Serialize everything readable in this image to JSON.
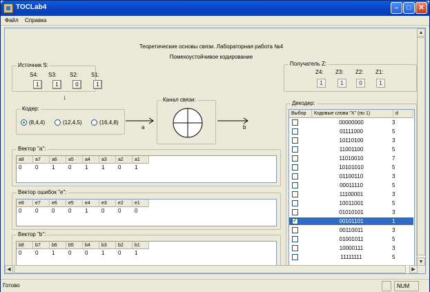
{
  "window": {
    "title": "TOCLab4"
  },
  "menu": {
    "file": "Файл",
    "help": "Справка"
  },
  "heading": {
    "line1": "Теоретические основы связи. Лабораторная работа №4",
    "line2": "Помехоустойчивое кодирование"
  },
  "source": {
    "label": "Источник S:",
    "bits": [
      {
        "name": "S4:",
        "value": "1"
      },
      {
        "name": "S3:",
        "value": "1"
      },
      {
        "name": "S2:",
        "value": "0"
      },
      {
        "name": "S1:",
        "value": "1"
      }
    ]
  },
  "receiver": {
    "label": "Получатель Z:",
    "bits": [
      {
        "name": "Z4:",
        "value": "1"
      },
      {
        "name": "Z3:",
        "value": "1"
      },
      {
        "name": "Z2:",
        "value": "0"
      },
      {
        "name": "Z1:",
        "value": "1"
      }
    ]
  },
  "coder": {
    "label": "Кодер:",
    "options": [
      "(8,4,4)",
      "(12,4,5)",
      "(16,4,8)"
    ],
    "selected": "(8,4,4)"
  },
  "channel": {
    "label": "Канал связи:"
  },
  "arrows": {
    "a": "a",
    "b": "b"
  },
  "vector_a": {
    "label": "Вектор \"a\":",
    "headers": [
      "a8",
      "a7",
      "a6",
      "a5",
      "a4",
      "a3",
      "a2",
      "a1"
    ],
    "values": [
      "0",
      "0",
      "1",
      "0",
      "1",
      "1",
      "0",
      "1"
    ]
  },
  "vector_e": {
    "label": "Вектор ошибок \"e\":",
    "headers": [
      "e8",
      "e7",
      "e6",
      "e5",
      "e4",
      "e3",
      "e2",
      "e1"
    ],
    "values": [
      "0",
      "0",
      "0",
      "0",
      "1",
      "0",
      "0",
      "0"
    ]
  },
  "vector_b": {
    "label": "Вектор \"b\":",
    "headers": [
      "b8",
      "b7",
      "b6",
      "b5",
      "b4",
      "b3",
      "b2",
      "b1"
    ],
    "values": [
      "0",
      "0",
      "1",
      "0",
      "0",
      "1",
      "0",
      "1"
    ]
  },
  "decoder": {
    "label": "Декодер:",
    "columns": [
      "Выбор",
      "Кодовые слова \"X\" (по 1)",
      "d"
    ],
    "rows": [
      {
        "code": "00000000",
        "d": "3",
        "checked": false
      },
      {
        "code": "01111000",
        "d": "5",
        "checked": false
      },
      {
        "code": "10110100",
        "d": "3",
        "checked": false
      },
      {
        "code": "11001100",
        "d": "5",
        "checked": false
      },
      {
        "code": "11010010",
        "d": "7",
        "checked": false
      },
      {
        "code": "10101010",
        "d": "5",
        "checked": false
      },
      {
        "code": "01100110",
        "d": "3",
        "checked": false
      },
      {
        "code": "00011110",
        "d": "5",
        "checked": false
      },
      {
        "code": "11100001",
        "d": "3",
        "checked": false
      },
      {
        "code": "10011001",
        "d": "5",
        "checked": false
      },
      {
        "code": "01010101",
        "d": "3",
        "checked": false
      },
      {
        "code": "00101101",
        "d": "1",
        "checked": true
      },
      {
        "code": "00110011",
        "d": "3",
        "checked": false
      },
      {
        "code": "01001011",
        "d": "5",
        "checked": false
      },
      {
        "code": "10000111",
        "d": "3",
        "checked": false
      },
      {
        "code": "11111111",
        "d": "5",
        "checked": false
      }
    ],
    "selected_index": 11
  },
  "status": {
    "text": "Готово",
    "num": "NUM"
  }
}
